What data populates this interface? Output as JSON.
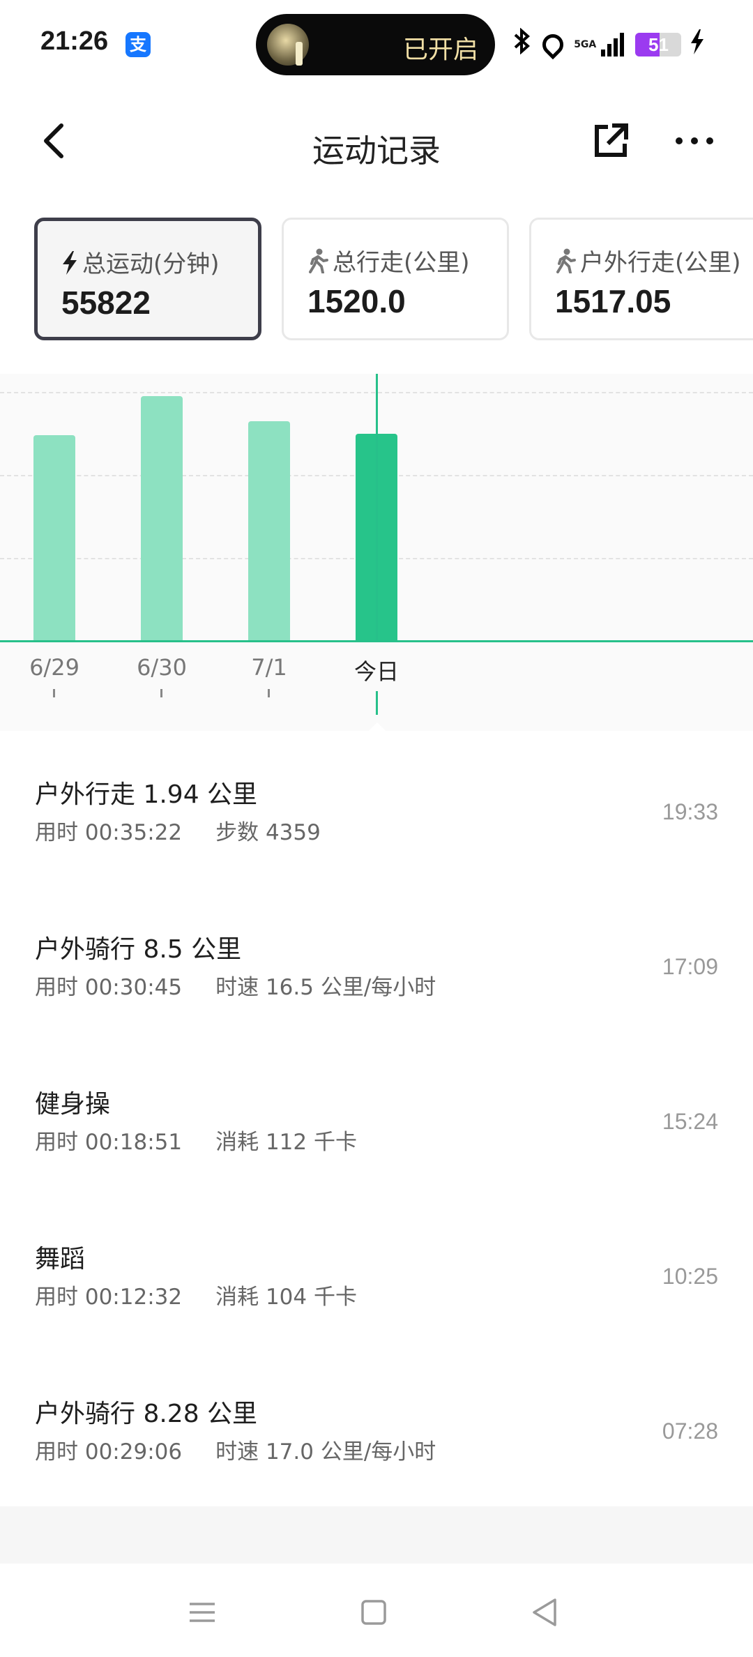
{
  "status_bar": {
    "time": "21:26",
    "alipay_glyph": "支",
    "island_label": "已开启",
    "network": "5GA",
    "battery": "51"
  },
  "header": {
    "title": "运动记录"
  },
  "cards": [
    {
      "label": "总运动(分钟)",
      "value": "55822",
      "icon": "bolt-icon"
    },
    {
      "label": "总行走(公里)",
      "value": "1520.0",
      "icon": "walk-icon"
    },
    {
      "label": "户外行走(公里)",
      "value": "1517.05",
      "icon": "walk-icon"
    }
  ],
  "chart": {
    "labels": [
      "6/29",
      "6/30",
      "7/1",
      "今日"
    ],
    "colors": {
      "bar": "#8de1c1",
      "bar_selected": "#27c48a"
    }
  },
  "records": [
    {
      "name": "户外行走 1.94 公里",
      "duration": "用时 00:35:22",
      "detail": "步数 4359",
      "time": "19:33"
    },
    {
      "name": "户外骑行 8.5 公里",
      "duration": "用时 00:30:45",
      "detail": "时速 16.5 公里/每小时",
      "time": "17:09"
    },
    {
      "name": "健身操",
      "duration": "用时 00:18:51",
      "detail": "消耗 112 千卡",
      "time": "15:24"
    },
    {
      "name": "舞蹈",
      "duration": "用时 00:12:32",
      "detail": "消耗 104 千卡",
      "time": "10:25"
    },
    {
      "name": "户外骑行 8.28 公里",
      "duration": "用时 00:29:06",
      "detail": "时速 17.0 公里/每小时",
      "time": "07:28"
    }
  ]
}
